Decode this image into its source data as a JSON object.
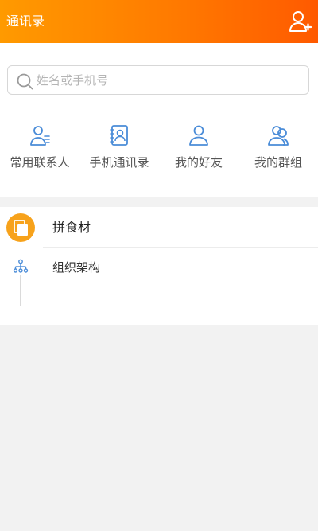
{
  "header": {
    "title": "通讯录",
    "add_icon": "add-contact-icon",
    "background_start": "#ff9a00",
    "background_end": "#ff5a00"
  },
  "search": {
    "placeholder": "姓名或手机号",
    "value": "",
    "icon": "search-icon"
  },
  "quick_actions": [
    {
      "label": "常用联系人",
      "icon": "frequent-contacts-icon"
    },
    {
      "label": "手机通讯录",
      "icon": "phone-contacts-icon"
    },
    {
      "label": "我的好友",
      "icon": "friend-icon"
    },
    {
      "label": "我的群组",
      "icon": "group-icon"
    }
  ],
  "organization": {
    "name": "拼食材",
    "badge_icon": "organization-badge-icon",
    "badge_color": "#f7a21b"
  },
  "structure": {
    "label": "组织架构",
    "icon": "org-structure-icon"
  },
  "colors": {
    "icon_blue": "#4a8cd8",
    "page_background": "#f2f2f2"
  }
}
